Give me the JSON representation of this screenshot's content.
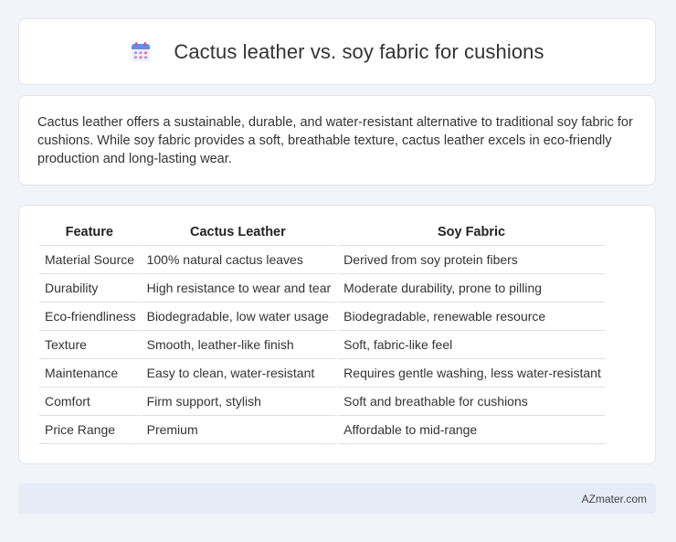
{
  "header": {
    "title": "Cactus leather vs. soy fabric for cushions",
    "icon": "calendar-icon"
  },
  "intro": {
    "text": "Cactus leather offers a sustainable, durable, and water-resistant alternative to traditional soy fabric for cushions. While soy fabric provides a soft, breathable texture, cactus leather excels in eco-friendly production and long-lasting wear."
  },
  "table": {
    "headers": [
      "Feature",
      "Cactus Leather",
      "Soy Fabric"
    ],
    "rows": [
      [
        "Material Source",
        "100% natural cactus leaves",
        "Derived from soy protein fibers"
      ],
      [
        "Durability",
        "High resistance to wear and tear",
        "Moderate durability, prone to pilling"
      ],
      [
        "Eco-friendliness",
        "Biodegradable, low water usage",
        "Biodegradable, renewable resource"
      ],
      [
        "Texture",
        "Smooth, leather-like finish",
        "Soft, fabric-like feel"
      ],
      [
        "Maintenance",
        "Easy to clean, water-resistant",
        "Requires gentle washing, less water-resistant"
      ],
      [
        "Comfort",
        "Firm support, stylish",
        "Soft and breathable for cushions"
      ],
      [
        "Price Range",
        "Premium",
        "Affordable to mid-range"
      ]
    ]
  },
  "footer": {
    "text": "AZmater.com"
  },
  "colors": {
    "background": "#f1f4f9",
    "card": "#ffffff",
    "footer_bg": "#e6ecf6",
    "row_divider": "#dcdfe4"
  }
}
